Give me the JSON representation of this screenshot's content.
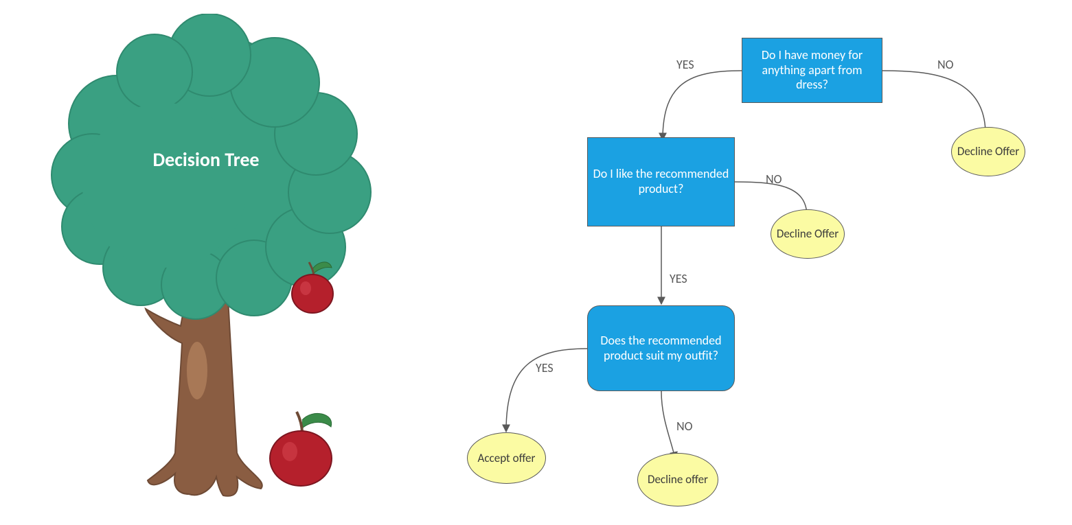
{
  "title": "Decision Tree",
  "nodes": {
    "q1": "Do I have money for anything apart from dress?",
    "q2": "Do I like the recommended product?",
    "q3": "Does the recommended product suit my outfit?",
    "decline1": "Decline Offer",
    "decline2": "Decline Offer",
    "decline3": "Decline offer",
    "accept": "Accept offer"
  },
  "labels": {
    "yes": "YES",
    "no": "NO"
  },
  "chart_data": {
    "type": "decision_tree",
    "title": "Decision Tree",
    "root": "q1",
    "nodes": [
      {
        "id": "q1",
        "kind": "question",
        "text": "Do I have money for anything apart from dress?",
        "yes": "q2",
        "no": "decline1"
      },
      {
        "id": "q2",
        "kind": "question",
        "text": "Do I like the recommended product?",
        "yes": "q3",
        "no": "decline2"
      },
      {
        "id": "q3",
        "kind": "question",
        "text": "Does the recommended product suit my outfit?",
        "yes": "accept",
        "no": "decline3"
      },
      {
        "id": "decline1",
        "kind": "leaf",
        "text": "Decline Offer",
        "result": "decline"
      },
      {
        "id": "decline2",
        "kind": "leaf",
        "text": "Decline Offer",
        "result": "decline"
      },
      {
        "id": "decline3",
        "kind": "leaf",
        "text": "Decline offer",
        "result": "decline"
      },
      {
        "id": "accept",
        "kind": "leaf",
        "text": "Accept offer",
        "result": "accept"
      }
    ]
  },
  "colors": {
    "question_bg": "#1ba1e2",
    "leaf_bg": "#fbfba3",
    "tree_foliage": "#3aa082",
    "tree_trunk": "#8a5d42",
    "apple": "#b5202c"
  }
}
